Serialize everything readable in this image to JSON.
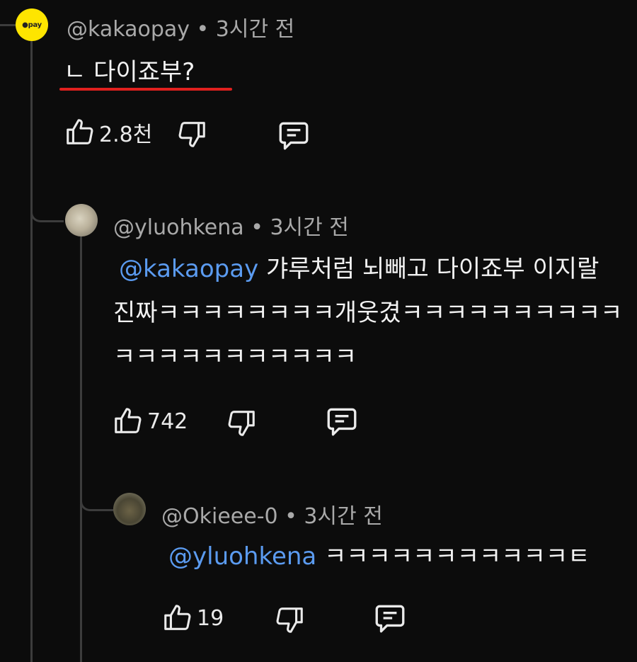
{
  "comments": [
    {
      "author": "@kakaopay",
      "separator": "•",
      "time": "3시간 전",
      "avatar_text": "●pay",
      "text": "ㄴ 다이죠부?",
      "likes": "2.8천"
    },
    {
      "author": "@yluohkena",
      "separator": "•",
      "time": "3시간 전",
      "mention": "@kakaopay",
      "line1": "갸루처럼 뇌빼고 다이죠부 이지랄",
      "line2": "진짜ㅋㅋㅋㅋㅋㅋㅋㅋ개웃겼ㅋㅋㅋㅋㅋㅋㅋㅋㅋㅋ",
      "line3": "ㅋㅋㅋㅋㅋㅋㅋㅋㅋㅋㅋ",
      "likes": "742"
    },
    {
      "author": "@Okieee-0",
      "separator": "•",
      "time": "3시간 전",
      "mention": "@yluohkena",
      "text": "ㅋㅋㅋㅋㅋㅋㅋㅋㅋㅋㅋㅌ",
      "likes": "19"
    }
  ],
  "colors": {
    "background": "#0c0c0c",
    "mention": "#5b9bf0",
    "highlight_underline": "#e0201e",
    "avatar_kakao": "#fee500"
  },
  "icons": [
    "thumbs-up-icon",
    "thumbs-down-icon",
    "reply-icon"
  ]
}
